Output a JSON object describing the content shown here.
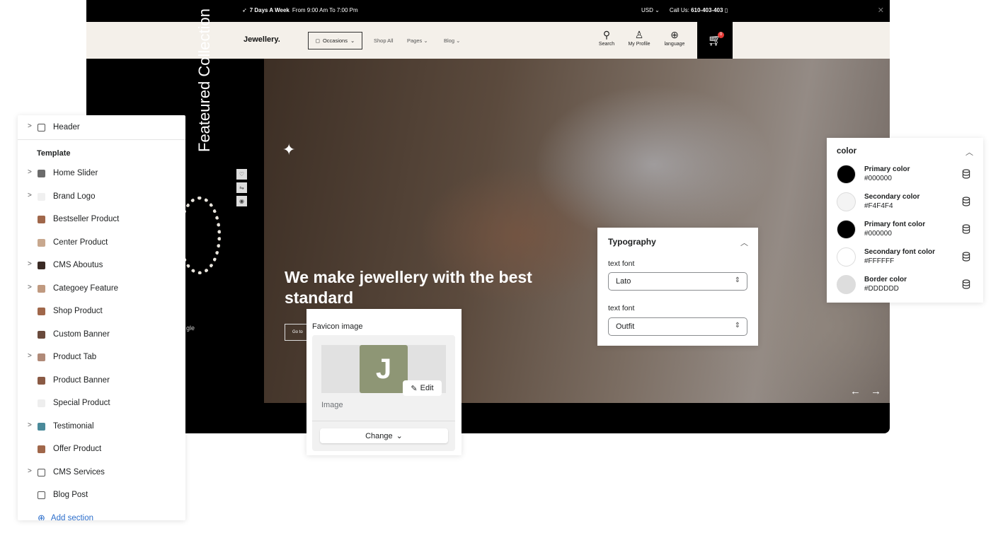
{
  "store": {
    "topbar": {
      "promo_bold": "7 Days A Week",
      "promo_text": "From 9:00 Am To 7:00 Pm",
      "currency": "USD",
      "call_label": "Call Us:",
      "call_number": "610-403-403"
    },
    "nav": {
      "brand": "Jewellery.",
      "occasions": "Occasions",
      "shop_all": "Shop All",
      "pages": "Pages",
      "blog": "Blog",
      "search": "Search",
      "profile": "My Profile",
      "language": "language",
      "cart_count": "0"
    },
    "side": {
      "featured": "Feateured Collection",
      "partial": "gle"
    },
    "hero": {
      "headline": "We make jewellery with the best standard",
      "button": "Go to"
    }
  },
  "sections": {
    "header": "Header",
    "template_label": "Template",
    "items": [
      {
        "label": "Home Slider",
        "chevron": true,
        "color": "#6b6b6b"
      },
      {
        "label": "Brand Logo",
        "chevron": true,
        "color": "#f0f0f0"
      },
      {
        "label": "Bestseller Product",
        "chevron": false,
        "color": "#a0674a"
      },
      {
        "label": "Center Product",
        "chevron": false,
        "color": "#c8a88e"
      },
      {
        "label": "CMS Aboutus",
        "chevron": true,
        "color": "#3a2a24"
      },
      {
        "label": "Categoey Feature",
        "chevron": true,
        "color": "#c09a80"
      },
      {
        "label": "Shop Product",
        "chevron": false,
        "color": "#a0674a"
      },
      {
        "label": "Custom Banner",
        "chevron": false,
        "color": "#6a4a3c"
      },
      {
        "label": "Product Tab",
        "chevron": true,
        "color": "#b08a78"
      },
      {
        "label": "Product Banner",
        "chevron": false,
        "color": "#8a5a44"
      },
      {
        "label": "Special Product",
        "chevron": false,
        "color": "#eeeeee"
      },
      {
        "label": "Testimonial",
        "chevron": true,
        "color": "#4a8a9a"
      },
      {
        "label": "Offer Product",
        "chevron": false,
        "color": "#a0674a"
      },
      {
        "label": "CMS Services",
        "chevron": true,
        "color": "#ffffff"
      },
      {
        "label": "Blog Post",
        "chevron": false,
        "color": "#ffffff"
      }
    ],
    "add_section": "Add section"
  },
  "favicon": {
    "title": "Favicon image",
    "letter": "J",
    "edit": "Edit",
    "image_label": "Image",
    "change": "Change"
  },
  "typography": {
    "title": "Typography",
    "fields": [
      {
        "label": "text font",
        "value": "Lato"
      },
      {
        "label": "text font",
        "value": "Outfit"
      }
    ]
  },
  "colors": {
    "title": "color",
    "items": [
      {
        "name": "Primary color",
        "hex": "#000000"
      },
      {
        "name": "Secondary color",
        "hex": "#F4F4F4"
      },
      {
        "name": "Primary font color",
        "hex": "#000000"
      },
      {
        "name": "Secondary font color",
        "hex": "#FFFFFF"
      },
      {
        "name": "Border color",
        "hex": "#DDDDDD"
      }
    ]
  }
}
